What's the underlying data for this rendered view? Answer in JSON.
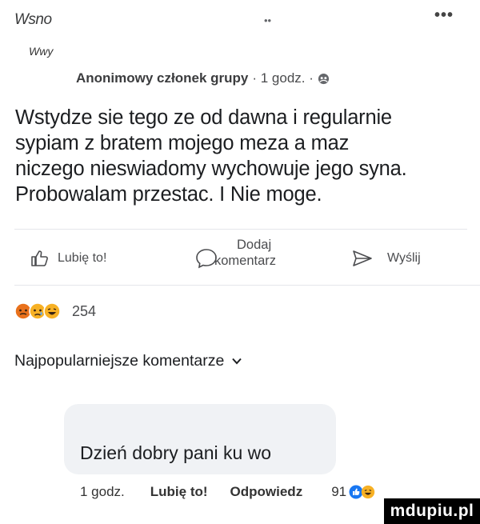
{
  "header": {
    "group_name": "Wsno",
    "subname": "Wwy",
    "more_label": "•••"
  },
  "post_meta": {
    "author": "Anonimowy członek grupy",
    "time": "· 1 godz. ·"
  },
  "post": {
    "lines": [
      "Wstydze sie tego ze od dawna i regularnie",
      "sypiam z bratem mojego meza a maz",
      "niczego nieswiadomy wychowuje jego syna.",
      "Probowalam przestac. I Nie moge."
    ]
  },
  "actions": {
    "like": "Lubię to!",
    "comment_line1": "Dodaj",
    "comment_line2": "komentarz",
    "share": "Wyślij"
  },
  "reactions": {
    "count": "254",
    "icons": [
      "angry-reaction",
      "sad-reaction",
      "laugh-reaction"
    ]
  },
  "comments_sort": {
    "label": "Najpopularniejsze komentarze"
  },
  "comment": {
    "text": "Dzień dobry pani ku wo",
    "time": "1 godz.",
    "like_label": "Lubię to!",
    "reply_label": "Odpowiedz",
    "reaction_count": "91"
  },
  "watermark": {
    "text": "mdupiu.pl"
  },
  "colors": {
    "like_blue": "#1877f2",
    "laugh_yellow": "#f7b125",
    "angry_orange": "#e9711c"
  }
}
